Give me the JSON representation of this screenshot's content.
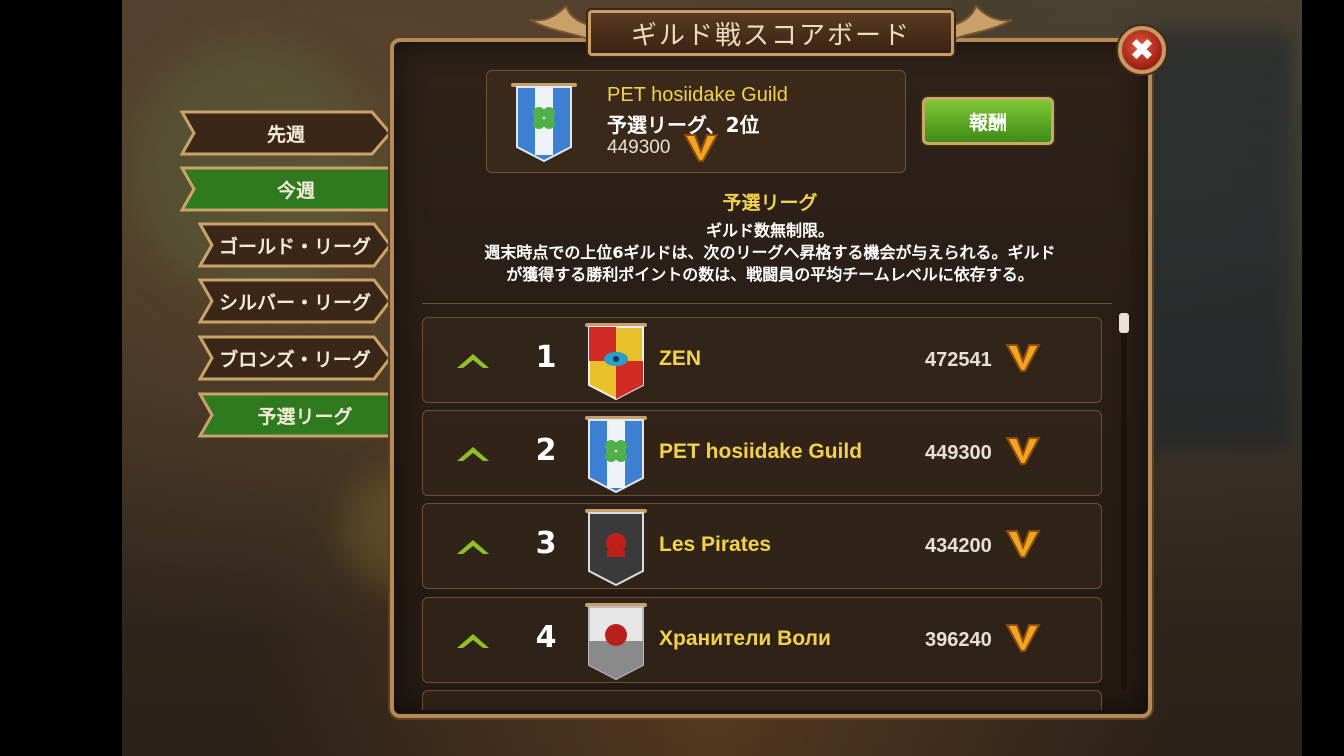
{
  "title": "ギルド戦スコアボード",
  "close_icon": "close-icon",
  "header": {
    "guild_name": "PET hosiidake Guild",
    "league_rank": "予選リーグ、2位",
    "score": "449300",
    "reward_label": "報酬"
  },
  "league": {
    "title": "予選リーグ",
    "desc_line1": "ギルド数無制限。",
    "desc_line2": "週末時点での上位6ギルドは、次のリーグへ昇格する機会が与えられる。ギルド",
    "desc_line3": "が獲得する勝利ポイントの数は、戦闘員の平均チームレベルに依存する。"
  },
  "tabs": [
    {
      "label": "先週",
      "active": false
    },
    {
      "label": "今週",
      "active": true
    },
    {
      "label": "ゴールド・リーグ",
      "active": false
    },
    {
      "label": "シルバー・リーグ",
      "active": false
    },
    {
      "label": "ブロンズ・リーグ",
      "active": false
    },
    {
      "label": "予選リーグ",
      "active": true
    }
  ],
  "rows": [
    {
      "rank": "1",
      "name": "ZEN",
      "score": "472541",
      "banner": "red-yellow-eye-banner"
    },
    {
      "rank": "2",
      "name": "PET hosiidake Guild",
      "score": "449300",
      "banner": "blue-clover-banner"
    },
    {
      "rank": "3",
      "name": "Les Pirates",
      "score": "434200",
      "banner": "black-skull-banner"
    },
    {
      "rank": "4",
      "name": "Хранители Воли",
      "score": "396240",
      "banner": "white-beast-banner"
    }
  ],
  "colors": {
    "accent": "#f3d14c",
    "active_tab": "#2f7a1f",
    "frame": "#b48a58"
  }
}
